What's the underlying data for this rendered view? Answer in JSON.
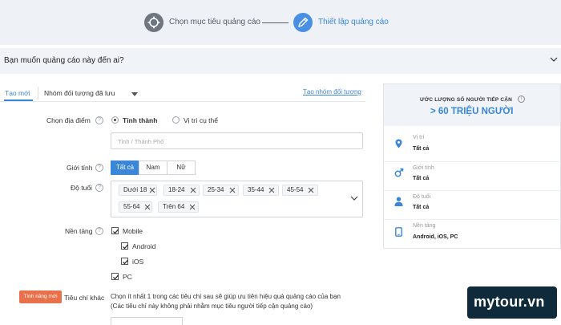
{
  "steps": [
    {
      "label": "Chọn mục tiêu quảng cáo",
      "icon": "crosshair-icon",
      "state": "done"
    },
    {
      "label": "Thiết lập quảng cáo",
      "icon": "pencil-icon",
      "state": "active"
    }
  ],
  "question": {
    "text": "Bạn muốn quảng cáo này đến ai?"
  },
  "tabs": {
    "new_label": "Tạo mới",
    "saved_label": "Nhóm đối tượng đã lưu",
    "create_link": "Tạo nhóm đối tượng"
  },
  "location": {
    "label": "Chọn địa điểm",
    "options": [
      "Tỉnh thành",
      "Vị trí cụ thể"
    ],
    "selected": "Tỉnh thành",
    "placeholder": "Tỉnh / Thành Phố"
  },
  "gender": {
    "label": "Giới tính",
    "options": [
      "Tất cả",
      "Nam",
      "Nữ"
    ],
    "selected": "Tất cả"
  },
  "age": {
    "label": "Độ tuổi",
    "chips": [
      "Dưới 18",
      "18-24",
      "25-34",
      "35-44",
      "45-54",
      "55-64",
      "Trên 64"
    ]
  },
  "platform": {
    "label": "Nền tảng",
    "items": [
      {
        "label": "Mobile",
        "checked": true
      },
      {
        "label": "Android",
        "checked": true
      },
      {
        "label": "iOS",
        "checked": true
      },
      {
        "label": "PC",
        "checked": true
      }
    ]
  },
  "other": {
    "badge": "Tính năng mới",
    "label": "Tiêu chí khác",
    "desc1": "Chọn ít nhất 1 trong các tiêu chí sau sẽ giúp ưu tiên hiệu quả quảng cáo của bạn",
    "desc2": "(Các tiêu chí này không phải nhằm mục tiêu người tiếp cận quảng cáo)"
  },
  "reach": {
    "title": "ƯỚC LƯỢNG SỐ NGƯỜI TIẾP CẬN",
    "value": "> 60 TRIỆU NGƯỜI",
    "rows": [
      {
        "key": "Vị trí",
        "value": "Tất cả",
        "icon": "location-pin-icon"
      },
      {
        "key": "Giới tính",
        "value": "Tất cả",
        "icon": "gender-icon"
      },
      {
        "key": "Độ tuổi",
        "value": "Tất cả",
        "icon": "person-icon"
      },
      {
        "key": "Nền tảng",
        "value": "Android, iOS, PC",
        "icon": "device-icon"
      }
    ]
  },
  "watermark": {
    "text": "mytour.vn"
  },
  "colors": {
    "accent": "#3a86d8",
    "badge": "#e8704a",
    "header_bg": "#eef1f6"
  }
}
